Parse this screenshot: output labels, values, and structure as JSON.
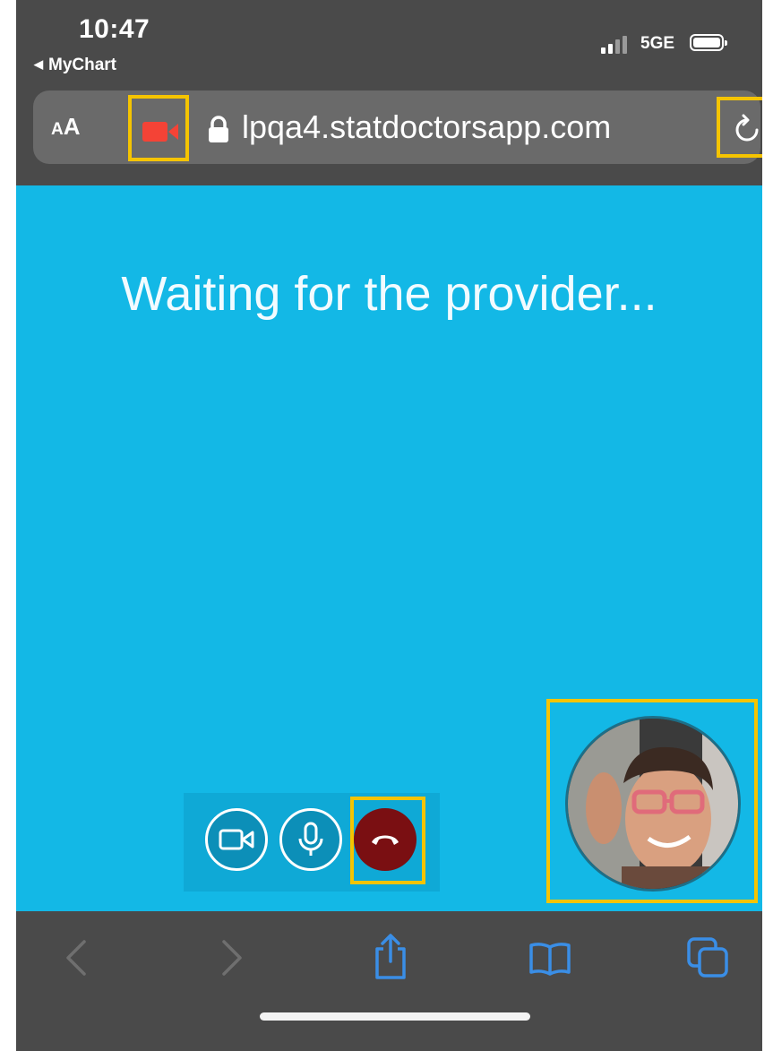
{
  "status_bar": {
    "time": "10:47",
    "back_app": "MyChart",
    "network": "5GE",
    "icons": [
      "signal-bars-icon",
      "battery-icon"
    ]
  },
  "browser": {
    "text_size_label_small": "A",
    "text_size_label_large": "A",
    "camera_indicator_icon": "video-camera-icon",
    "lock_icon": "lock-icon",
    "url": "lpqa4.statdoctorsapp.com",
    "reload_icon": "reload-icon"
  },
  "call": {
    "status_text": "Waiting for the provider...",
    "controls": [
      {
        "name": "camera",
        "icon": "video-camera-icon"
      },
      {
        "name": "microphone",
        "icon": "microphone-icon"
      },
      {
        "name": "end-call",
        "icon": "hang-up-icon"
      }
    ],
    "self_view": "self-view-video"
  },
  "toolbar": {
    "items": [
      "back-icon",
      "forward-icon",
      "share-icon",
      "bookmarks-icon",
      "tabs-icon"
    ]
  },
  "colors": {
    "call_background": "#13b8e6",
    "end_call": "#7a0f12",
    "highlight": "#f5c400",
    "recording_red": "#f44336",
    "toolbar_active": "#3a8ee6",
    "toolbar_inactive": "#6f6f6f"
  }
}
